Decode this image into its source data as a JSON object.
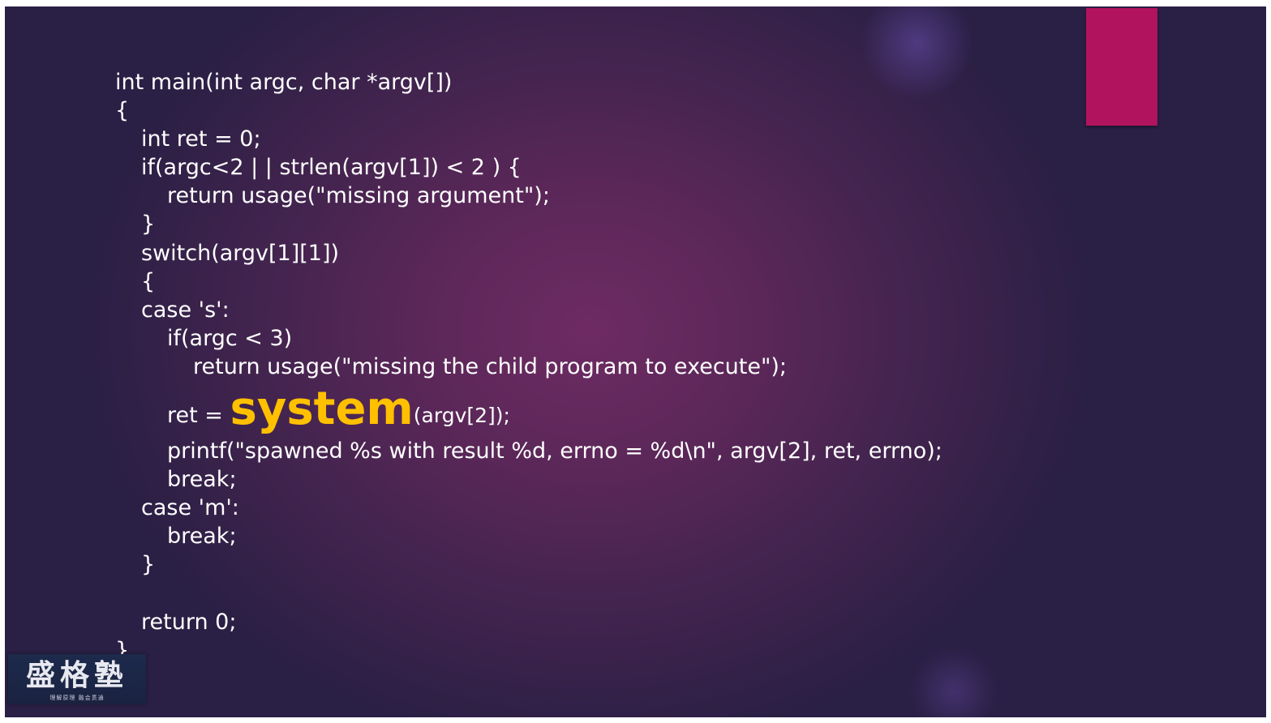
{
  "code_lines": [
    "int main(int argc, char *argv[])",
    "{",
    "int ret = 0;",
    "if(argc<2 | | strlen(argv[1]) < 2 ) {",
    "return usage(\"missing argument\");",
    "}",
    "switch(argv[1][1])",
    "{",
    "case 's':",
    "if(argc < 3)",
    "return usage(\"missing the child program to execute\");",
    "ret = ",
    "system",
    "(argv[2]);",
    "printf(\"spawned %s with result %d, errno = %d\\n\", argv[2], ret, errno);",
    "break;",
    "case 'm':",
    "break;",
    "}",
    "",
    "return 0;",
    "}"
  ],
  "logo": {
    "text": "盛格塾",
    "tagline": "理解原理 融会贯通"
  },
  "colors": {
    "accent_bar": "#b2135f",
    "highlight": "#ffc000",
    "code_text": "#ffffff",
    "background_center": "#6e2b63",
    "background_edge": "#2a1f44"
  }
}
